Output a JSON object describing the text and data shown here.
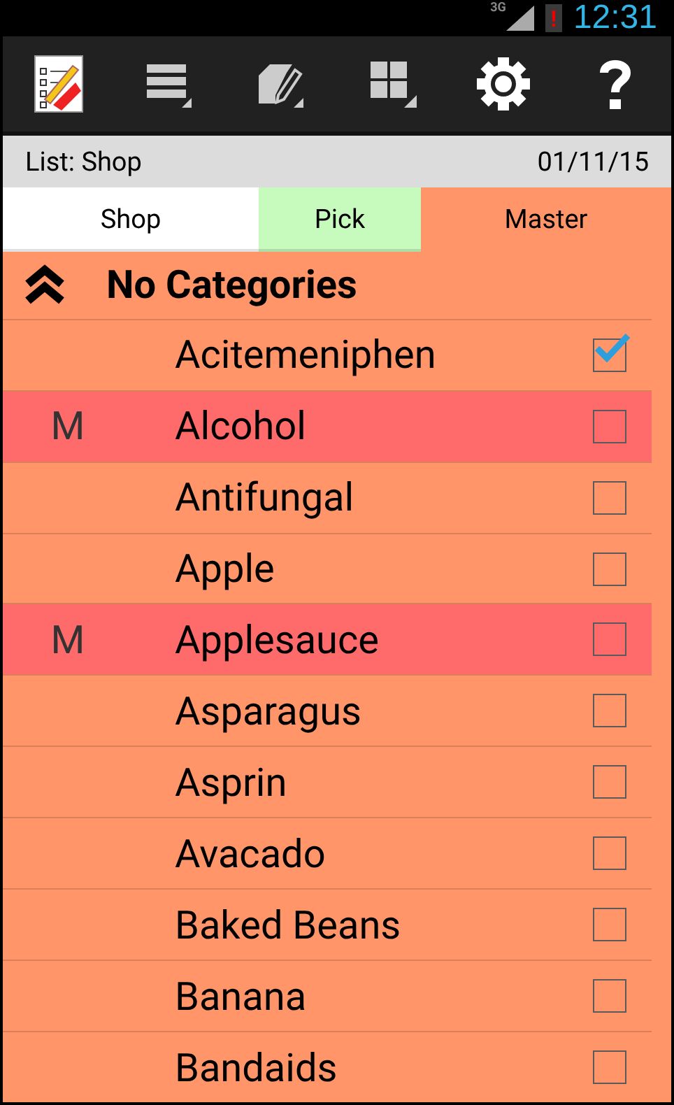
{
  "status_bar": {
    "network": "3G",
    "alert": "!",
    "time": "12:31"
  },
  "list_header": {
    "title": "List: Shop",
    "date": "01/11/15"
  },
  "tabs": [
    {
      "label": "Shop",
      "selected": false,
      "color": "#ffffff"
    },
    {
      "label": "Pick",
      "selected": false,
      "color": "#c6fbbd"
    },
    {
      "label": "Master",
      "selected": true,
      "color": "#ff9568"
    }
  ],
  "category": {
    "title": "No Categories",
    "expanded": true
  },
  "items": [
    {
      "name": "Acitemeniphen",
      "checked": true,
      "highlighted": false
    },
    {
      "name": "Alcohol",
      "checked": false,
      "highlighted": true,
      "mark": "M"
    },
    {
      "name": "Antifungal",
      "checked": false,
      "highlighted": false
    },
    {
      "name": "Apple",
      "checked": false,
      "highlighted": false
    },
    {
      "name": "Applesauce",
      "checked": false,
      "highlighted": true,
      "mark": "M"
    },
    {
      "name": "Asparagus",
      "checked": false,
      "highlighted": false
    },
    {
      "name": "Asprin",
      "checked": false,
      "highlighted": false
    },
    {
      "name": "Avacado",
      "checked": false,
      "highlighted": false
    },
    {
      "name": "Baked Beans",
      "checked": false,
      "highlighted": false
    },
    {
      "name": "Banana",
      "checked": false,
      "highlighted": false
    },
    {
      "name": "Bandaids",
      "checked": false,
      "highlighted": false
    }
  ]
}
